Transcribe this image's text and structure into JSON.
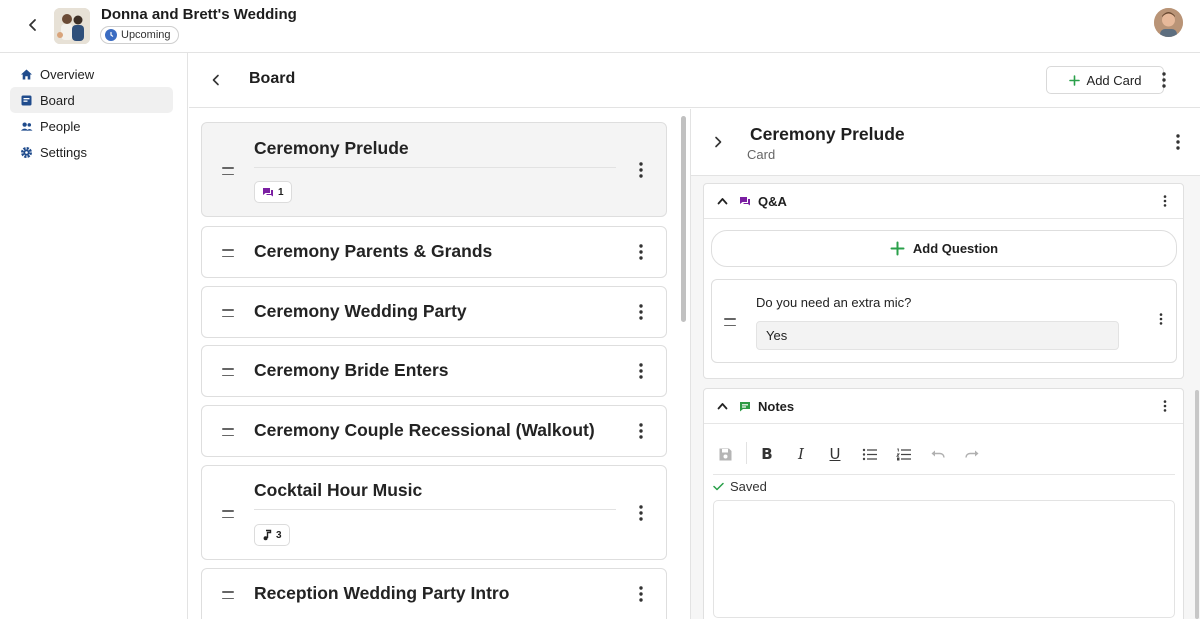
{
  "header": {
    "event_title": "Donna and Brett's Wedding",
    "status": "Upcoming"
  },
  "sidebar": {
    "items": [
      {
        "label": "Overview",
        "icon": "home-icon"
      },
      {
        "label": "Board",
        "icon": "board-icon",
        "active": true
      },
      {
        "label": "People",
        "icon": "people-icon"
      },
      {
        "label": "Settings",
        "icon": "gear-icon"
      }
    ]
  },
  "board": {
    "title": "Board",
    "add_card_label": "Add Card",
    "cards": [
      {
        "title": "Ceremony Prelude",
        "badge_icon": "chat-icon",
        "badge_count": "1"
      },
      {
        "title": "Ceremony Parents & Grands"
      },
      {
        "title": "Ceremony Wedding Party"
      },
      {
        "title": "Ceremony Bride Enters"
      },
      {
        "title": "Ceremony Couple Recessional (Walkout)"
      },
      {
        "title": "Cocktail Hour Music",
        "badge_icon": "music-note-icon",
        "badge_count": "3"
      },
      {
        "title": "Reception Wedding Party Intro"
      }
    ]
  },
  "detail": {
    "title": "Ceremony Prelude",
    "subtitle": "Card",
    "qa": {
      "title": "Q&A",
      "add_question_label": "Add Question",
      "question": "Do you need an extra mic?",
      "answer": "Yes"
    },
    "notes": {
      "title": "Notes",
      "toolbar_buttons": [
        "B",
        "I",
        "U"
      ],
      "saved_label": "Saved"
    }
  },
  "colors": {
    "accent_green": "#2aa04a",
    "chat_purple": "#7b1fa2",
    "notes_green": "#2e9b45",
    "status_blue": "#3b6cc2"
  }
}
